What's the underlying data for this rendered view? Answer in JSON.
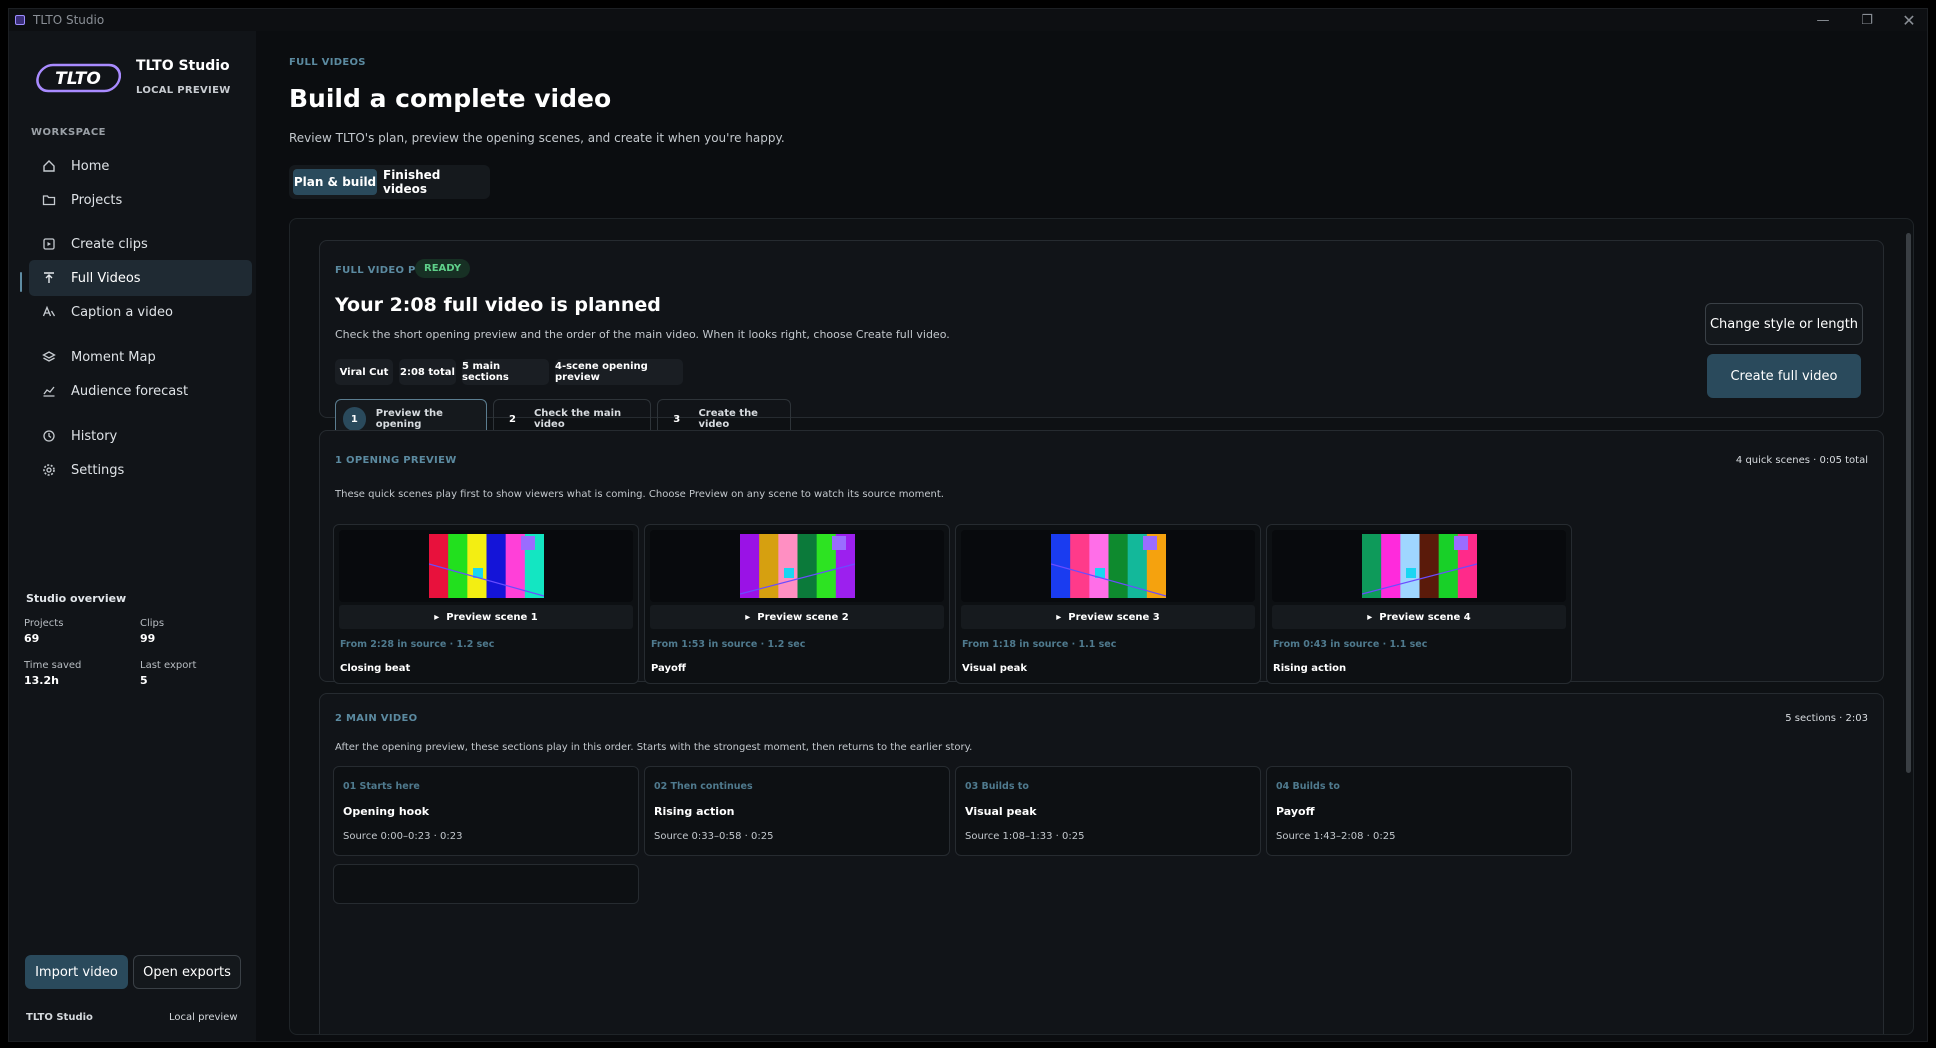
{
  "window": {
    "title": "TLTO Studio",
    "minimize_icon": "minimize-icon",
    "restore_icon": "restore-icon",
    "close_icon": "close-icon"
  },
  "sidebar": {
    "logo_text": "TLTO",
    "brand": "TLTO Studio",
    "brand_sub": "LOCAL PREVIEW",
    "section_label": "WORKSPACE",
    "items": [
      {
        "label": "Home",
        "icon": "home-icon"
      },
      {
        "label": "Projects",
        "icon": "folder-icon"
      },
      {
        "label": "Create clips",
        "icon": "clip-icon"
      },
      {
        "label": "Full Videos",
        "icon": "upload-icon",
        "active": true
      },
      {
        "label": "Caption a video",
        "icon": "caption-icon"
      },
      {
        "label": "Moment Map",
        "icon": "layers-icon"
      },
      {
        "label": "Audience forecast",
        "icon": "chart-icon"
      },
      {
        "label": "History",
        "icon": "history-icon"
      },
      {
        "label": "Settings",
        "icon": "gear-icon"
      }
    ],
    "overview": {
      "title": "Studio overview",
      "projects_label": "Projects",
      "projects_value": "69",
      "clips_label": "Clips",
      "clips_value": "99",
      "time_label": "Time saved",
      "time_value": "13.2h",
      "export_label": "Last export",
      "export_value": "5"
    },
    "import_label": "Import video",
    "exports_label": "Open exports",
    "footer_left": "TLTO Studio",
    "footer_right": "Local preview"
  },
  "main": {
    "breadcrumb": "FULL VIDEOS",
    "title": "Build a complete video",
    "subtitle": "Review TLTO's plan, preview the opening scenes, and create it when you're happy.",
    "tabs": [
      {
        "label": "Plan & build",
        "active": true
      },
      {
        "label": "Finished videos"
      }
    ],
    "plan": {
      "label": "FULL VIDEO PLAN",
      "badge": "READY",
      "heading": "Your 2:08 full video is planned",
      "description": "Check the short opening preview and the order of the main video. When it looks right, choose Create full video.",
      "chips": [
        "Viral Cut",
        "2:08 total",
        "5 main sections",
        "4-scene opening preview"
      ],
      "steps": [
        {
          "num": "1",
          "label": "Preview the opening",
          "active": true
        },
        {
          "num": "2",
          "label": "Check the main video"
        },
        {
          "num": "3",
          "label": "Create the video"
        }
      ],
      "change_label": "Change style or length",
      "create_label": "Create full video"
    },
    "opening": {
      "label": "1  OPENING PREVIEW",
      "meta": "4 quick scenes · 0:05 total",
      "description": "These quick scenes play first to show viewers what is coming. Choose Preview on any scene to watch its source moment.",
      "scenes": [
        {
          "preview": "Preview scene 1",
          "source": "From 2:28 in source · 1.2 sec",
          "name": "Closing beat",
          "colors": [
            "#e8113c",
            "#22e01e",
            "#f3ee12",
            "#1414d8",
            "#ff40d8",
            "#13e6c2"
          ]
        },
        {
          "preview": "Preview scene 2",
          "source": "From 1:53 in source · 1.2 sec",
          "name": "Payoff",
          "colors": [
            "#9a12e6",
            "#d6a010",
            "#ff8fc2",
            "#0b7a3a",
            "#2de322",
            "#9c20ee"
          ]
        },
        {
          "preview": "Preview scene 3",
          "source": "From 1:18 in source · 1.1 sec",
          "name": "Visual peak",
          "colors": [
            "#1a3cf0",
            "#ff3a8a",
            "#ff6ee8",
            "#0e8a2e",
            "#13b89a",
            "#f5a20e"
          ]
        },
        {
          "preview": "Preview scene 4",
          "source": "From 0:43 in source · 1.1 sec",
          "name": "Rising action",
          "colors": [
            "#0e9a5a",
            "#ff2adc",
            "#9fd6ff",
            "#5a1a0a",
            "#18d028",
            "#ff2a8a"
          ]
        }
      ]
    },
    "main_video": {
      "label": "2  MAIN VIDEO",
      "meta": "5 sections · 2:03",
      "description": "After the opening preview, these sections play in this order. Starts with the strongest moment, then returns to the earlier story.",
      "sections": [
        {
          "kicker": "01  Starts here",
          "title": "Opening hook",
          "source": "Source 0:00–0:23  ·  0:23"
        },
        {
          "kicker": "02  Then continues",
          "title": "Rising action",
          "source": "Source 0:33–0:58  ·  0:25"
        },
        {
          "kicker": "03  Builds to",
          "title": "Visual peak",
          "source": "Source 1:08–1:33  ·  0:25"
        },
        {
          "kicker": "04  Builds to",
          "title": "Payoff",
          "source": "Source 1:43–2:08  ·  0:25"
        }
      ]
    }
  }
}
